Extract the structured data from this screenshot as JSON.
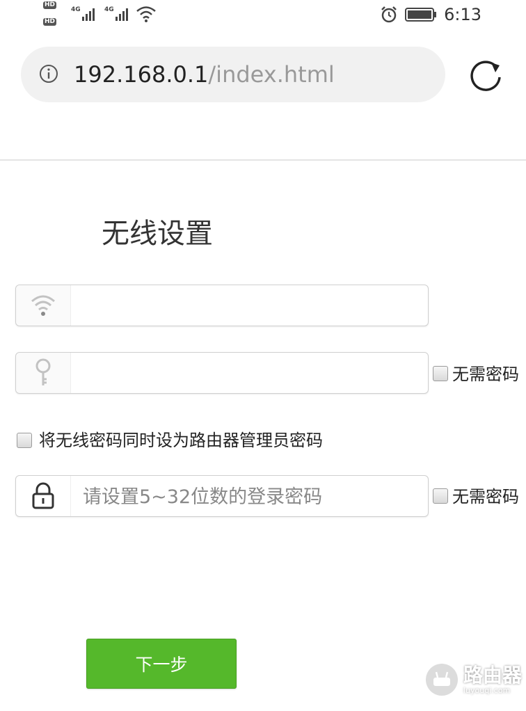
{
  "status_bar": {
    "hd1": "HD",
    "hd2": "HD",
    "sim1": "4G",
    "sim2": "4G",
    "time": "6:13"
  },
  "address_bar": {
    "host": "192.168.0.1",
    "path": "/index.html"
  },
  "page": {
    "title": "无线设置",
    "wifi_name_field": {
      "value": "",
      "placeholder": ""
    },
    "wifi_password_field": {
      "value": "",
      "placeholder": "",
      "no_password_label": "无需密码",
      "no_password_checked": false
    },
    "same_as_admin": {
      "label": "将无线密码同时设为路由器管理员密码",
      "checked": false
    },
    "admin_password_field": {
      "value": "",
      "placeholder": "请设置5~32位数的登录密码",
      "no_password_label": "无需密码",
      "no_password_checked": false
    },
    "next_button": "下一步"
  },
  "watermark": {
    "main": "路由器",
    "sub": "luyouqi.com"
  },
  "colors": {
    "accent_green": "#55b82b",
    "url_bar_bg": "#f1f1f1"
  }
}
